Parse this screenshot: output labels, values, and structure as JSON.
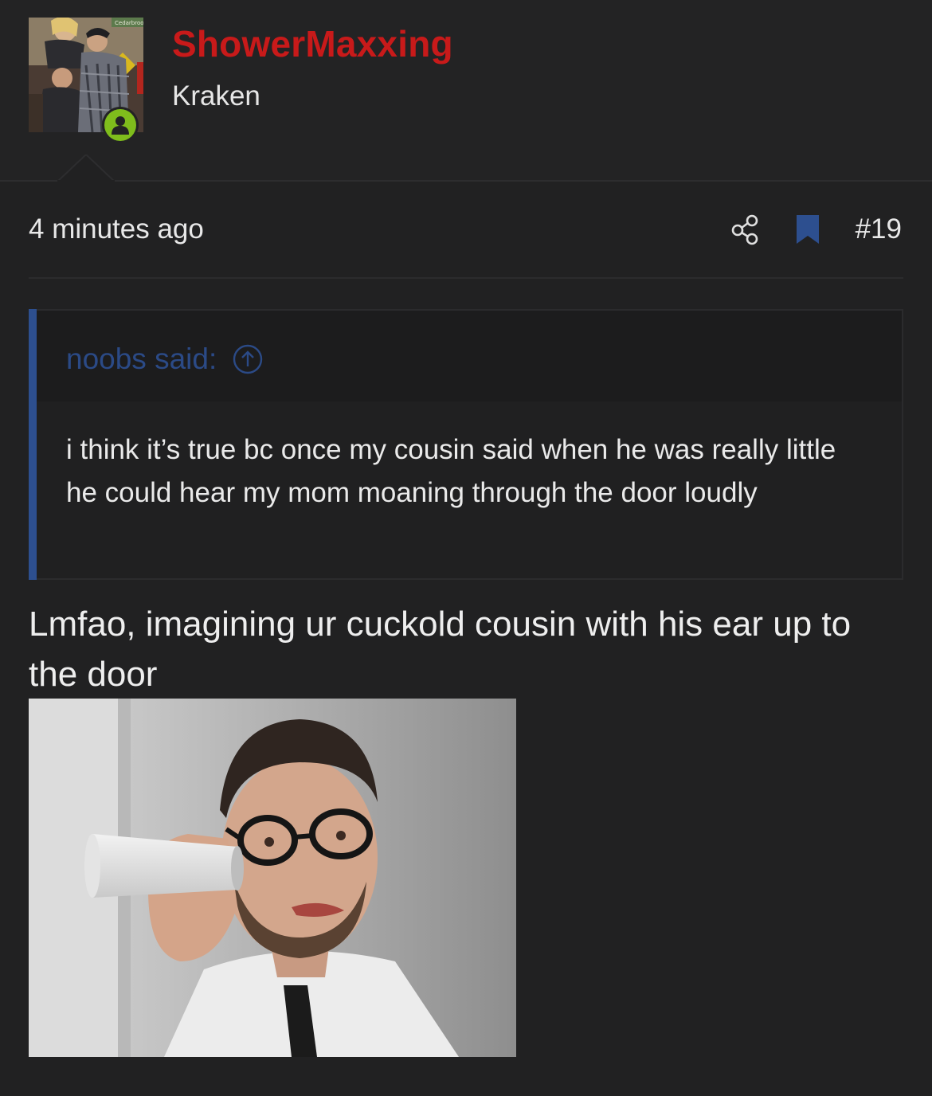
{
  "user": {
    "name": "ShowerMaxxing",
    "title": "Kraken",
    "name_color": "#c81a1a",
    "online_color": "#7fbd1c"
  },
  "avatar": {
    "sign_text": "Cedarbrook",
    "icon": "user-avatar-photo"
  },
  "post": {
    "time": "4 minutes ago",
    "number": "#19",
    "icons": [
      "share-icon",
      "bookmark-icon"
    ]
  },
  "quote": {
    "author": "noobs said:",
    "body": "i think it’s true bc once my cousin said when he was really little he could hear my mom moaning through the door loudly",
    "accent_color": "#2d4f8f",
    "icon": "arrow-up-circle-icon"
  },
  "reply": {
    "text": "Lmfao, imagining ur cuckold cousin with his ear up to the door",
    "image_icon": "man-listening-with-cup-photo"
  }
}
